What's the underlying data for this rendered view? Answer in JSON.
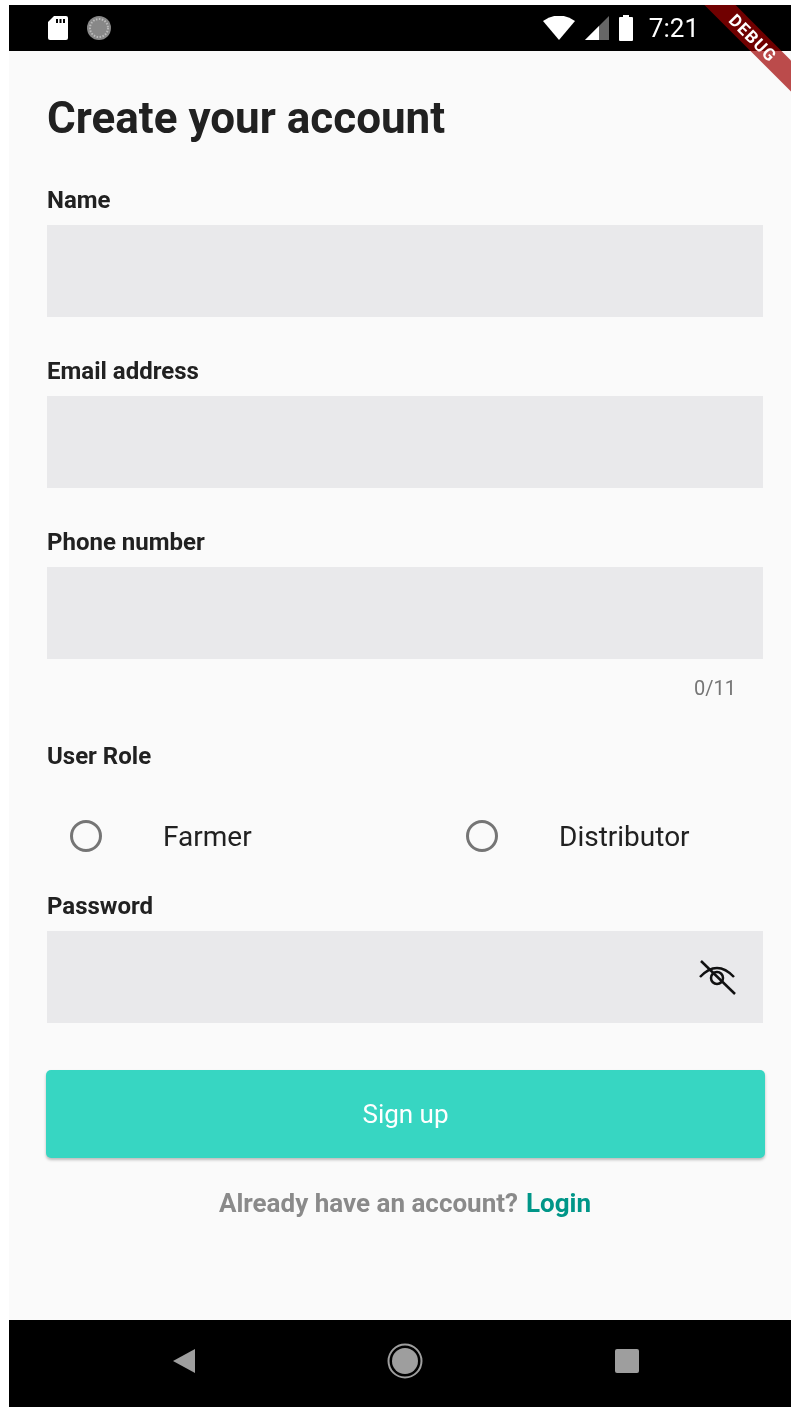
{
  "status_bar": {
    "time": "7:21"
  },
  "debug_banner": "DEBUG",
  "title": "Create your account",
  "fields": [
    {
      "label": "Name"
    },
    {
      "label": "Email address"
    },
    {
      "label": "Phone number",
      "counter": "0/11"
    }
  ],
  "role": {
    "label": "User Role",
    "options": [
      {
        "label": "Farmer",
        "selected": false
      },
      {
        "label": "Distributor",
        "selected": false
      }
    ]
  },
  "password": {
    "label": "Password",
    "visible": false
  },
  "submit": "Sign up",
  "footer": {
    "text": "Already have an account?",
    "link": "Login"
  }
}
